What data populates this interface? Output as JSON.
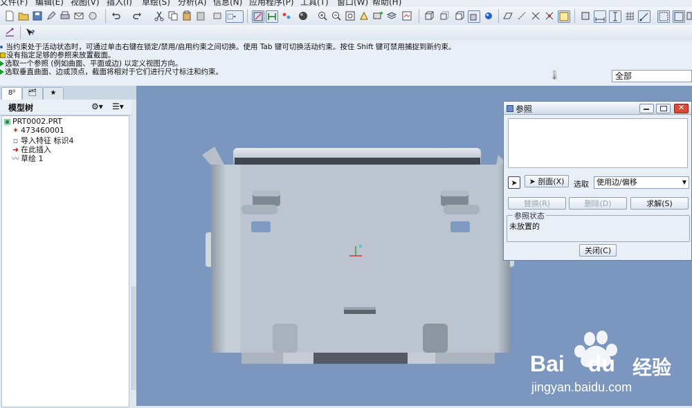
{
  "menubar": {
    "items": [
      "文件(F)",
      "编辑(E)",
      "视图(V)",
      "插入(I)",
      "草绘(S)",
      "分析(A)",
      "信息(N)",
      "应用程序(P)",
      "工具(T)",
      "窗口(W)",
      "帮助(H)"
    ]
  },
  "messages": [
    "当约束处于活动状态时，可通过单击右键在锁定/禁用/启用约束之间切换。使用 Tab 键可切换活动约束。按住 Shift 键可禁用捕捉到新约束。",
    "没有指定足够的参照来放置截面。",
    "选取一个参照 (例如曲面、平面或边) 以定义视图方向。",
    "选取垂直曲面、边或顶点，截面将相对于它们进行尺寸标注和约束。"
  ],
  "filter": {
    "value": "全部"
  },
  "model_tree": {
    "title": "模型树",
    "items": [
      {
        "label": "PRT0002.PRT",
        "icon": "part-icon"
      },
      {
        "label": "473460001",
        "icon": "datum-csys-icon"
      },
      {
        "label": "导入特征 标识4",
        "icon": "import-feature-icon"
      },
      {
        "label": "在此插入",
        "icon": "insert-here-arrow-icon"
      },
      {
        "label": "草绘 1",
        "icon": "sketch-icon"
      }
    ]
  },
  "dialog": {
    "title": "参照",
    "section_button": "剖面(X)",
    "select_label": "选取",
    "select_value": "使用边/偏移",
    "replace_button": "替换(R)",
    "delete_button": "删除(D)",
    "solve_button": "求解(S)",
    "status_legend": "参照状态",
    "status_value": "未放置的",
    "close_button": "关闭(C)"
  },
  "watermark": {
    "brand": "Bai",
    "brand2": "du",
    "cn": "经验",
    "url": "jingyan.baidu.com"
  }
}
